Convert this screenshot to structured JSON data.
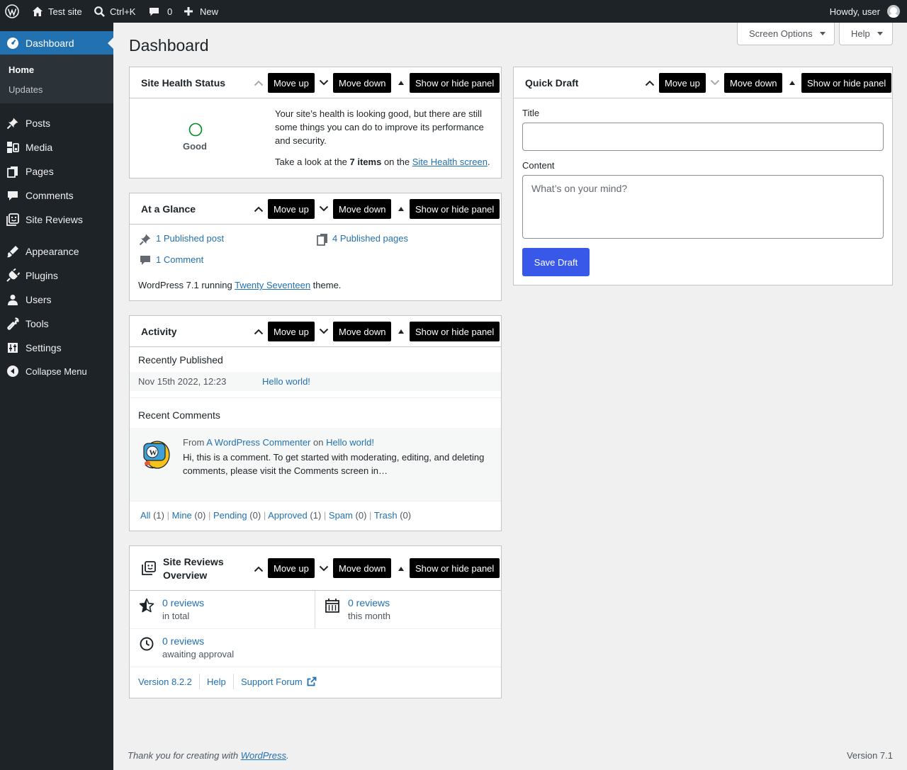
{
  "adminbar": {
    "site_name": "Test site",
    "search_shortcut": "Ctrl+K",
    "comments_count": "0",
    "new_label": "New",
    "howdy": "Howdy, user"
  },
  "sidebar": {
    "dashboard": "Dashboard",
    "submenu": [
      "Home",
      "Updates"
    ],
    "items": [
      "Posts",
      "Media",
      "Pages",
      "Comments",
      "Site Reviews",
      "Appearance",
      "Plugins",
      "Users",
      "Tools",
      "Settings",
      "Collapse Menu"
    ]
  },
  "header": {
    "title": "Dashboard",
    "screen_options": "Screen Options",
    "help": "Help"
  },
  "tooltips": {
    "move_up": "Move up",
    "move_down": "Move down",
    "toggle": "Show or hide panel"
  },
  "site_health": {
    "title": "Site Health Status",
    "status": "Good",
    "message": "Your site’s health is looking good, but there are still some things you can do to improve its performance and security.",
    "take_look_prefix": "Take a look at the ",
    "items_count": "7 items",
    "on_the": " on the ",
    "screen_link": "Site Health screen",
    "period": "."
  },
  "glance": {
    "title": "At a Glance",
    "posts": "1 Published post",
    "pages": "4 Published pages",
    "comments": "1 Comment",
    "running_prefix": "WordPress 7.1 running ",
    "theme": "Twenty Seventeen",
    "running_suffix": " theme."
  },
  "activity": {
    "title": "Activity",
    "recently_published": "Recently Published",
    "pub_date": "Nov 15th 2022, 12:23",
    "pub_title": "Hello world!",
    "recent_comments": "Recent Comments",
    "from": "From ",
    "commenter": "A WordPress Commenter",
    "on": " on ",
    "comment_post": "Hello world!",
    "comment_excerpt": "Hi, this is a comment. To get started with moderating, editing, and deleting comments, please visit the Comments screen in…",
    "filters": [
      {
        "label": "All",
        "count": "(1)"
      },
      {
        "label": "Mine",
        "count": "(0)"
      },
      {
        "label": "Pending",
        "count": "(0)"
      },
      {
        "label": "Approved",
        "count": "(1)"
      },
      {
        "label": "Spam",
        "count": "(0)"
      },
      {
        "label": "Trash",
        "count": "(0)"
      }
    ],
    "sep": "|"
  },
  "reviews": {
    "title_line1": "Site Reviews",
    "title_line2": "Overview",
    "total_count": "0 reviews",
    "total_label": "in total",
    "month_count": "0 reviews",
    "month_label": "this month",
    "awaiting_count": "0 reviews",
    "awaiting_label": "awaiting approval",
    "version": "Version 8.2.2",
    "help": "Help",
    "support": "Support Forum"
  },
  "quick_draft": {
    "title": "Quick Draft",
    "title_label": "Title",
    "title_value": "",
    "content_label": "Content",
    "content_placeholder": "What’s on your mind?",
    "save": "Save Draft"
  },
  "footer": {
    "thanks_prefix": "Thank you for creating with ",
    "wordpress": "WordPress",
    "thanks_suffix": ".",
    "version": "Version 7.1"
  },
  "colors": {
    "accent": "#2271b1",
    "admin_bg": "#1d2327",
    "health_good": "#008a20"
  }
}
